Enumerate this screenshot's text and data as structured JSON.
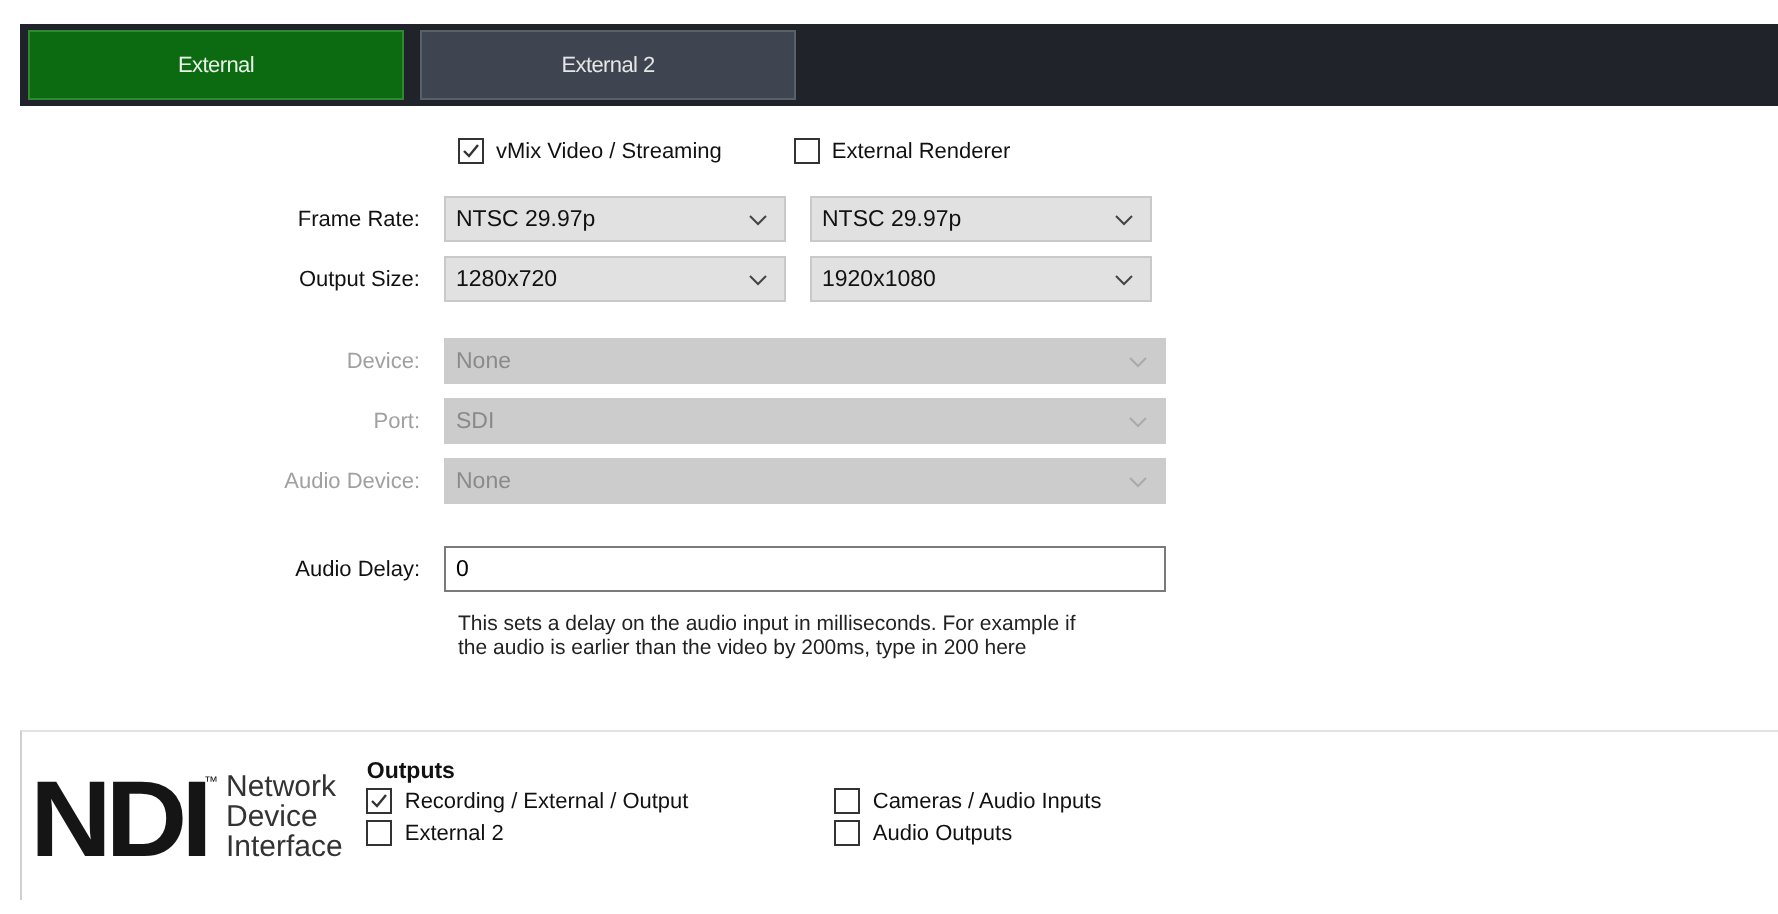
{
  "tabs": [
    {
      "label": "External",
      "selected": true
    },
    {
      "label": "External 2",
      "selected": false
    }
  ],
  "render_options": [
    {
      "label": "vMix Video / Streaming",
      "checked": true
    },
    {
      "label": "External Renderer",
      "checked": false
    }
  ],
  "fields": [
    {
      "label": "Frame Rate:",
      "disabled": false,
      "values": [
        "NTSC 29.97p",
        "NTSC 29.97p"
      ]
    },
    {
      "label": "Output Size:",
      "disabled": false,
      "values": [
        "1280x720",
        "1920x1080"
      ]
    },
    {
      "label": "Device:",
      "disabled": true,
      "values": [
        "None"
      ]
    },
    {
      "label": "Port:",
      "disabled": true,
      "values": [
        "SDI"
      ]
    },
    {
      "label": "Audio Device:",
      "disabled": true,
      "values": [
        "None"
      ]
    }
  ],
  "audio_delay": {
    "label": "Audio Delay:",
    "value": "0",
    "help_lines": [
      "This sets a delay on the audio input in milliseconds. For example if",
      "the audio is earlier than the video by 200ms, type in 200 here"
    ]
  },
  "ndi": {
    "logo": "NDI",
    "trademark": "™",
    "tagline": [
      "Network",
      "Device",
      "Interface"
    ],
    "outputs_title": "Outputs",
    "outputs": [
      {
        "label": "Recording / External / Output",
        "checked": true
      },
      {
        "label": "External 2",
        "checked": false
      },
      {
        "label": "Cameras / Audio Inputs",
        "checked": false
      },
      {
        "label": "Audio Outputs",
        "checked": false
      }
    ]
  }
}
